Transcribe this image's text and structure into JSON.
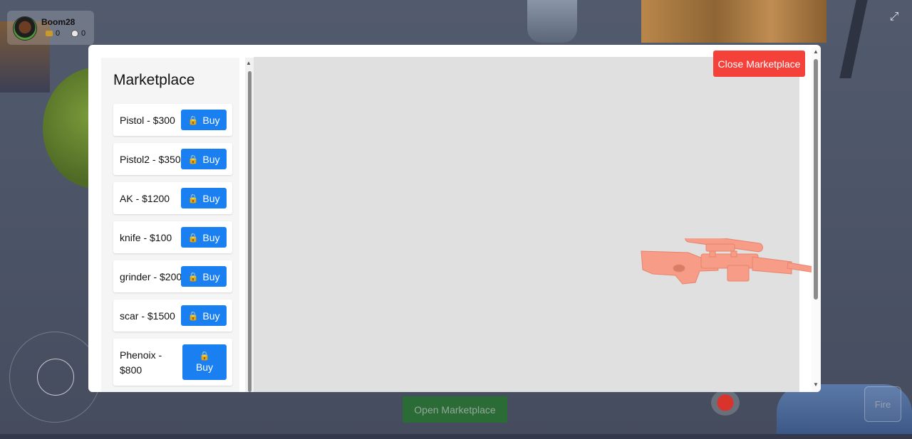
{
  "player": {
    "name": "Boom28",
    "guns": "0",
    "kills": "0"
  },
  "marketplace": {
    "title": "Marketplace",
    "buy_label": "Buy",
    "items": [
      {
        "label": "Pistol - $300"
      },
      {
        "label": "Pistol2 - $350"
      },
      {
        "label": "AK - $1200"
      },
      {
        "label": "knife - $100"
      },
      {
        "label": "grinder - $200"
      },
      {
        "label": "scar - $1500"
      },
      {
        "label_line1": "Phenoix -",
        "label_line2": "$800"
      }
    ],
    "close_label": "Close Marketplace",
    "preview_model": "sniper-rifle",
    "preview_color": "#f79c86",
    "viewer_bg": "#e0e0e0"
  },
  "hud": {
    "open_marketplace_label": "Open Marketplace",
    "fire_label": "Fire"
  },
  "colors": {
    "buy": "#1a7ff0",
    "close": "#f4413a",
    "open_marketplace": "#2a6b36"
  }
}
